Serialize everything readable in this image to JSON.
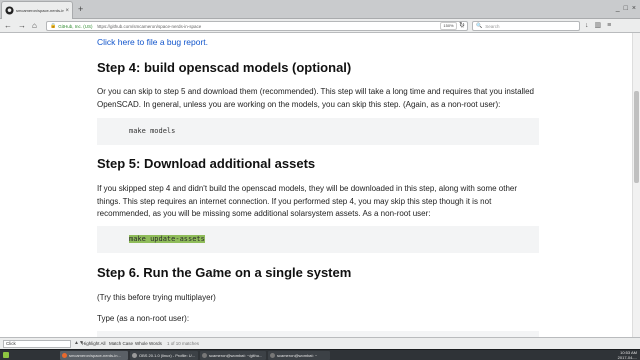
{
  "browser": {
    "tab_title": "smcameron/space-nerds-in...",
    "tab_close": "×",
    "new_tab": "+",
    "window_controls": [
      "_",
      "□",
      "×"
    ],
    "nav_back": "←",
    "nav_forward": "→",
    "nav_home": "⌂",
    "site_identity": "GitHub, Inc. (US)",
    "url": "https://github.com/smcameron/space-nerds-in-space",
    "zoom": "150%",
    "search_placeholder": "Search"
  },
  "article": {
    "bug_link": "Click here to file a bug report.",
    "step4_heading": "Step 4: build openscad models (optional)",
    "step4_text": "Or you can skip to step 5 and download them (recommended). This step will take a long time and requires that you installed OpenSCAD. In general, unless you are working on the models, you can skip this step. (Again, as a non-root user):",
    "step4_code": "make models",
    "step5_heading": "Step 5: Download additional assets",
    "step5_text": "If you skipped step 4 and didn't build the openscad models, they will be downloaded in this step, along with some other things. This step requires an internet connection. If you performed step 4, you may skip this step though it is not recommended, as you will be missing some additional solarsystem assets. As a non-root user:",
    "step5_code": "make update-assets",
    "step6_heading": "Step 6. Run the Game on a single system",
    "step6_note": "(Try this before trying multiplayer)",
    "step6_type": "Type (as a non-root user):"
  },
  "findbar": {
    "query": "Click",
    "highlight_all": "Highlight All",
    "match_case": "Match Case",
    "whole_words": "Whole Words",
    "status": "1 of 10 matches"
  },
  "taskbar": {
    "items": [
      {
        "label": "smcameron/space-nerds-in...",
        "color": "#e8692d",
        "active": true
      },
      {
        "label": "OBS 20.1.0 (linux) - Profile: U...",
        "color": "#5b5b5b",
        "active": false
      },
      {
        "label": "scameron@wombat: ~/githu...",
        "color": "#4a4a4a",
        "active": false
      },
      {
        "label": "scameron@wombat: ~",
        "color": "#4a4a4a",
        "active": false
      }
    ],
    "clock_time": "10:53 AM",
    "clock_date": "2017-04-..."
  },
  "colors": {
    "link": "#1155cc",
    "code_highlight": "#8fbc5a",
    "taskbar": "#2f3337"
  }
}
